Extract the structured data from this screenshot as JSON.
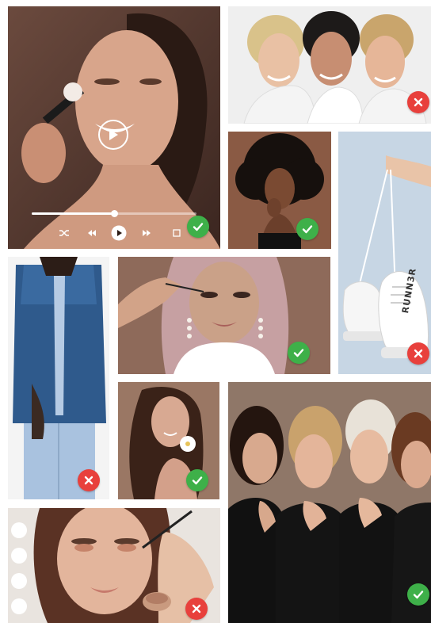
{
  "player": {
    "progress": 0.5,
    "controls": [
      "shuffle-icon",
      "previous-icon",
      "play-icon",
      "next-icon",
      "stop-icon"
    ],
    "center": "play-icon"
  },
  "colors": {
    "ok": "#3eb049",
    "no": "#e8403c"
  },
  "shoe": {
    "brand": "RUNN3R"
  },
  "tiles": [
    {
      "name": "tile-makeup-brush-video",
      "status": "approved"
    },
    {
      "name": "tile-three-women",
      "status": "rejected"
    },
    {
      "name": "tile-curly-hair-portrait",
      "status": "approved"
    },
    {
      "name": "tile-white-sneakers",
      "status": "rejected"
    },
    {
      "name": "tile-denim-jacket",
      "status": "rejected"
    },
    {
      "name": "tile-headscarf-mascara",
      "status": "approved"
    },
    {
      "name": "tile-flower-portrait",
      "status": "approved"
    },
    {
      "name": "tile-five-women-group",
      "status": "approved"
    },
    {
      "name": "tile-eyeshadow-application",
      "status": "rejected"
    }
  ]
}
